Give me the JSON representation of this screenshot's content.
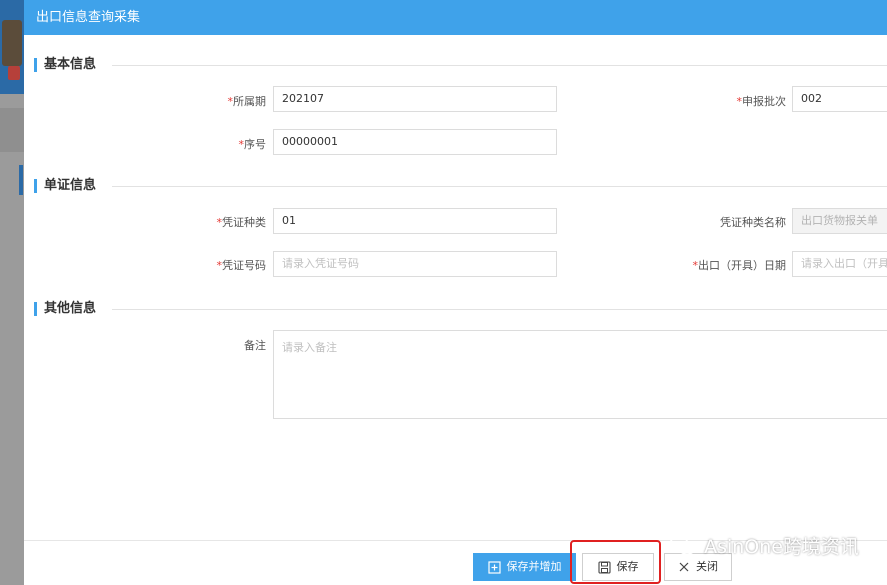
{
  "dialog": {
    "title": "出口信息查询采集"
  },
  "sections": {
    "basic": "基本信息",
    "voucher": "单证信息",
    "other": "其他信息"
  },
  "fields": {
    "period": {
      "label": "所属期",
      "value": "202107"
    },
    "batch": {
      "label": "申报批次",
      "value": "002"
    },
    "seq": {
      "label": "序号",
      "value": "00000001"
    },
    "voucher_type": {
      "label": "凭证种类",
      "value": "01"
    },
    "voucher_type_name": {
      "label": "凭证种类名称",
      "value": "出口货物报关单"
    },
    "voucher_no": {
      "label": "凭证号码",
      "placeholder": "请录入凭证号码"
    },
    "export_date": {
      "label": "出口（开具）日期",
      "placeholder": "请录入出口（开具）日期"
    },
    "remark": {
      "label": "备注",
      "placeholder": "请录入备注"
    }
  },
  "required_mark": "*",
  "buttons": {
    "save_and_add": "保存并增加",
    "save": "保存",
    "close": "关闭"
  },
  "watermark": "AsinOne跨境资讯",
  "colors": {
    "accent": "#3fa2ea",
    "required": "#e53935",
    "highlight": "#e02020"
  }
}
